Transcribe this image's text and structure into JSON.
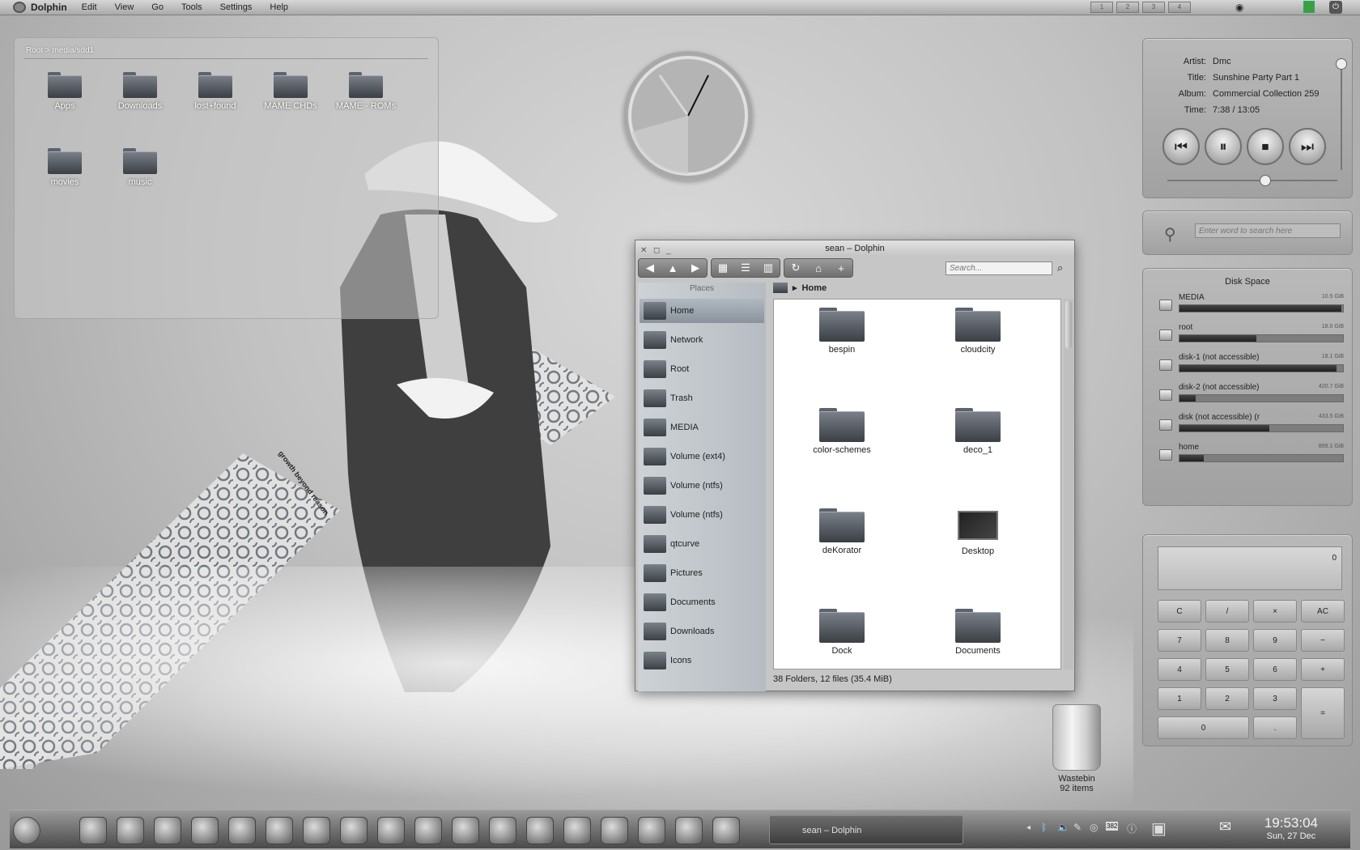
{
  "menubar": {
    "app": "Dolphin",
    "items": [
      "Edit",
      "View",
      "Go",
      "Tools",
      "Settings",
      "Help"
    ],
    "pager": [
      "1",
      "2",
      "3",
      "4"
    ]
  },
  "folderview": {
    "breadcrumb": "Root > media/sdd1",
    "items": [
      "Apps",
      "Downloads",
      "lost+found",
      "MAME CHDs",
      "MAME - ROMs",
      "movies",
      "music"
    ]
  },
  "motto": "growth beyond reason",
  "player": {
    "artist_k": "Artist:",
    "artist": "Dmc",
    "title_k": "Title:",
    "title": "Sunshine Party Part 1",
    "album_k": "Album:",
    "album": "Commercial Collection 259",
    "time_k": "Time:",
    "time": "7:38 / 13:05",
    "progress": 0.58,
    "volume": 1.0,
    "icons": [
      "previous-icon",
      "pause-icon",
      "stop-icon",
      "next-icon"
    ]
  },
  "search": {
    "placeholder": "Enter word to search here"
  },
  "disk": {
    "title": "Disk Space",
    "items": [
      {
        "name": "MEDIA",
        "size": "10.5 GiB",
        "used": 0.99
      },
      {
        "name": "root",
        "size": "18.0 GiB",
        "used": 0.47
      },
      {
        "name": "disk-1 (not accessible)",
        "size": "18.1 GiB",
        "used": 0.96
      },
      {
        "name": "disk-2 (not accessible)",
        "size": "420.7 GiB",
        "used": 0.1
      },
      {
        "name": "disk (not accessible) (r",
        "size": "433.5 GiB",
        "used": 0.55
      },
      {
        "name": "home",
        "size": "899.1 GiB",
        "used": 0.15
      }
    ]
  },
  "calc": {
    "display": "0",
    "buttons": [
      "C",
      "/",
      "×",
      "AC",
      "7",
      "8",
      "9",
      "−",
      "4",
      "5",
      "6",
      "+",
      "1",
      "2",
      "3",
      "=",
      "0",
      "."
    ]
  },
  "dolphin": {
    "title": "sean – Dolphin",
    "search_placeholder": "Search...",
    "places_header": "Places",
    "places": [
      "Home",
      "Network",
      "Root",
      "Trash",
      "MEDIA",
      "Volume (ext4)",
      "Volume (ntfs)",
      "Volume (ntfs)",
      "qtcurve",
      "Pictures",
      "Documents",
      "Downloads",
      "Icons"
    ],
    "crumb": "Home",
    "items": [
      "bespin",
      "cloudcity",
      "color-schemes",
      "deco_1",
      "deKorator",
      "Desktop",
      "Dock",
      "Documents"
    ],
    "status": "38 Folders, 12 files (35.4 MiB)"
  },
  "wastebin": {
    "label": "Wastebin",
    "count": "92 items"
  },
  "taskbar": {
    "task": "sean – Dolphin",
    "time": "19:53:04",
    "date": "Sun, 27 Dec",
    "tray_battery": "382"
  }
}
